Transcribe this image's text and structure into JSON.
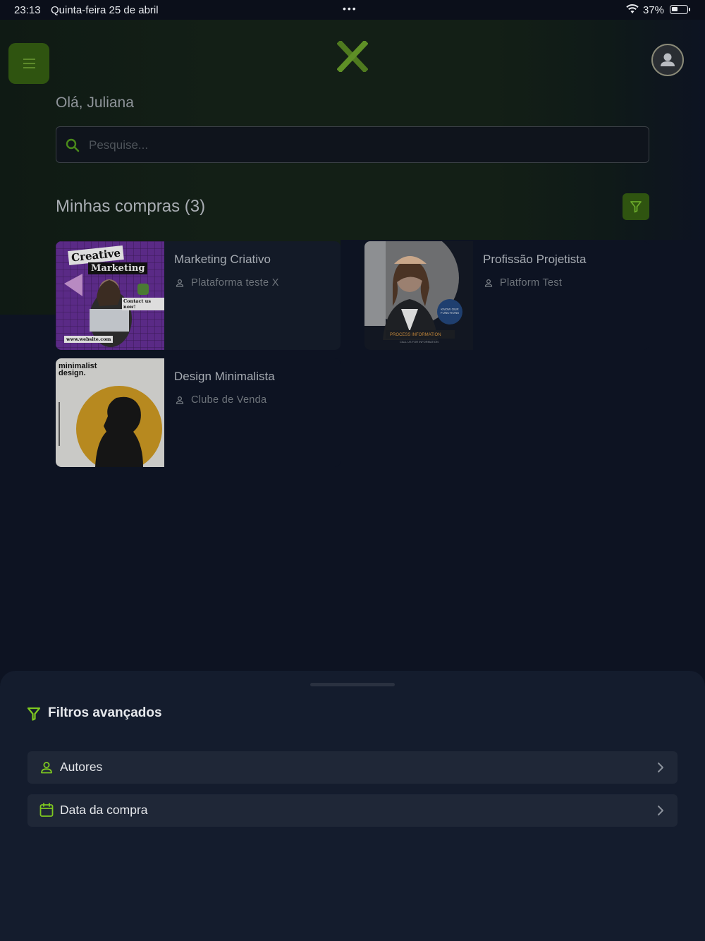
{
  "status_bar": {
    "time": "23:13",
    "date": "Quinta-feira 25 de abril",
    "dots": "•••",
    "battery": "37%"
  },
  "header": {
    "greeting": "Olá, Juliana",
    "search_placeholder": "Pesquise..."
  },
  "purchases": {
    "title": "Minhas compras (3)",
    "items": [
      {
        "title": "Marketing Criativo",
        "author": "Plataforma teste X",
        "thumb_texts": [
          "Creative",
          "Marketing",
          "Contact us now!",
          "www.website.com"
        ]
      },
      {
        "title": "Profissão Projetista",
        "author": "Platform Test",
        "thumb_texts": [
          "KNOW OUR FUNCTIONS",
          "PROCESS INFORMATION",
          "CALL US FOR INFORMATION"
        ]
      },
      {
        "title": "Design Minimalista",
        "author": "Clube de Venda",
        "thumb_texts": [
          "minimalist design."
        ]
      }
    ]
  },
  "filters_sheet": {
    "title": "Filtros avançados",
    "rows": [
      {
        "label": "Autores",
        "icon": "user-icon"
      },
      {
        "label": "Data da compra",
        "icon": "calendar-icon"
      }
    ]
  },
  "colors": {
    "accent_green": "#7ec820",
    "background": "#0d1322",
    "sheet": "#141c2d",
    "row": "#1f2737"
  }
}
